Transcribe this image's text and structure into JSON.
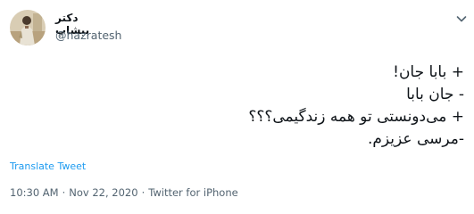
{
  "author": {
    "display_name": "دکتر بیشاپ",
    "handle": "@hazratesh",
    "avatar_icon": "profile-photo"
  },
  "menu_icon": "chevron-down-icon",
  "tweet": {
    "lines": [
      "+ بابا جان!",
      "- جان بابا",
      "+ می‌دونستی تو همه زندگیمی؟؟؟",
      "-مرسی عزیزم."
    ]
  },
  "translate_label": "Translate Tweet",
  "meta": {
    "time": "10:30 AM",
    "date": "Nov 22, 2020",
    "source": "Twitter for iPhone",
    "separator": "·"
  },
  "colors": {
    "link": "#1d9bf0",
    "secondary_text": "#536471"
  }
}
